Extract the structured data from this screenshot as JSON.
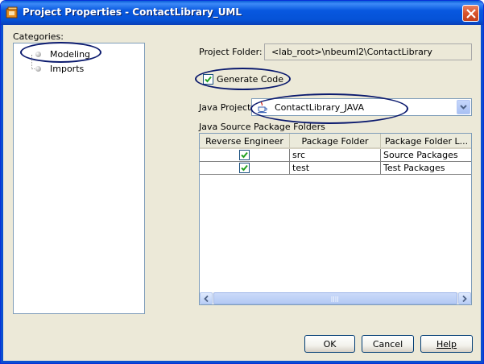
{
  "window": {
    "title": "Project Properties - ContactLibrary_UML",
    "close_icon": "close-icon",
    "app_icon": "netbeans-project-icon"
  },
  "categories": {
    "label": "Categories:",
    "items": [
      {
        "label": "Modeling",
        "icon": "tree-node-dot-icon",
        "selected": true
      },
      {
        "label": "Imports",
        "icon": "tree-node-dot-icon",
        "selected": false
      }
    ]
  },
  "form": {
    "project_folder_label": "Project Folder:",
    "project_folder_value": "<lab_root>\\nbeuml2\\ContactLibrary",
    "generate_code_label": "Generate Code",
    "generate_code_checked": true,
    "java_project_label": "Java Project:",
    "java_project_value": "ContactLibrary_JAVA",
    "java_project_icon": "java-coffee-cup-icon",
    "source_folders_label": "Java Source Package Folders"
  },
  "table": {
    "columns": [
      "Reverse Engineer",
      "Package Folder",
      "Package Folder L..."
    ],
    "rows": [
      {
        "reverse_engineer": true,
        "package_folder": "src",
        "package_folder_label": "Source Packages"
      },
      {
        "reverse_engineer": true,
        "package_folder": "test",
        "package_folder_label": "Test Packages"
      }
    ]
  },
  "buttons": {
    "ok": "OK",
    "cancel": "Cancel",
    "help": "Help"
  },
  "colors": {
    "titlebar": "#0858e0",
    "dialog_bg": "#ece9d8",
    "annotation_ellipse": "#0b1a6e",
    "checkbox_check": "#21a121"
  }
}
